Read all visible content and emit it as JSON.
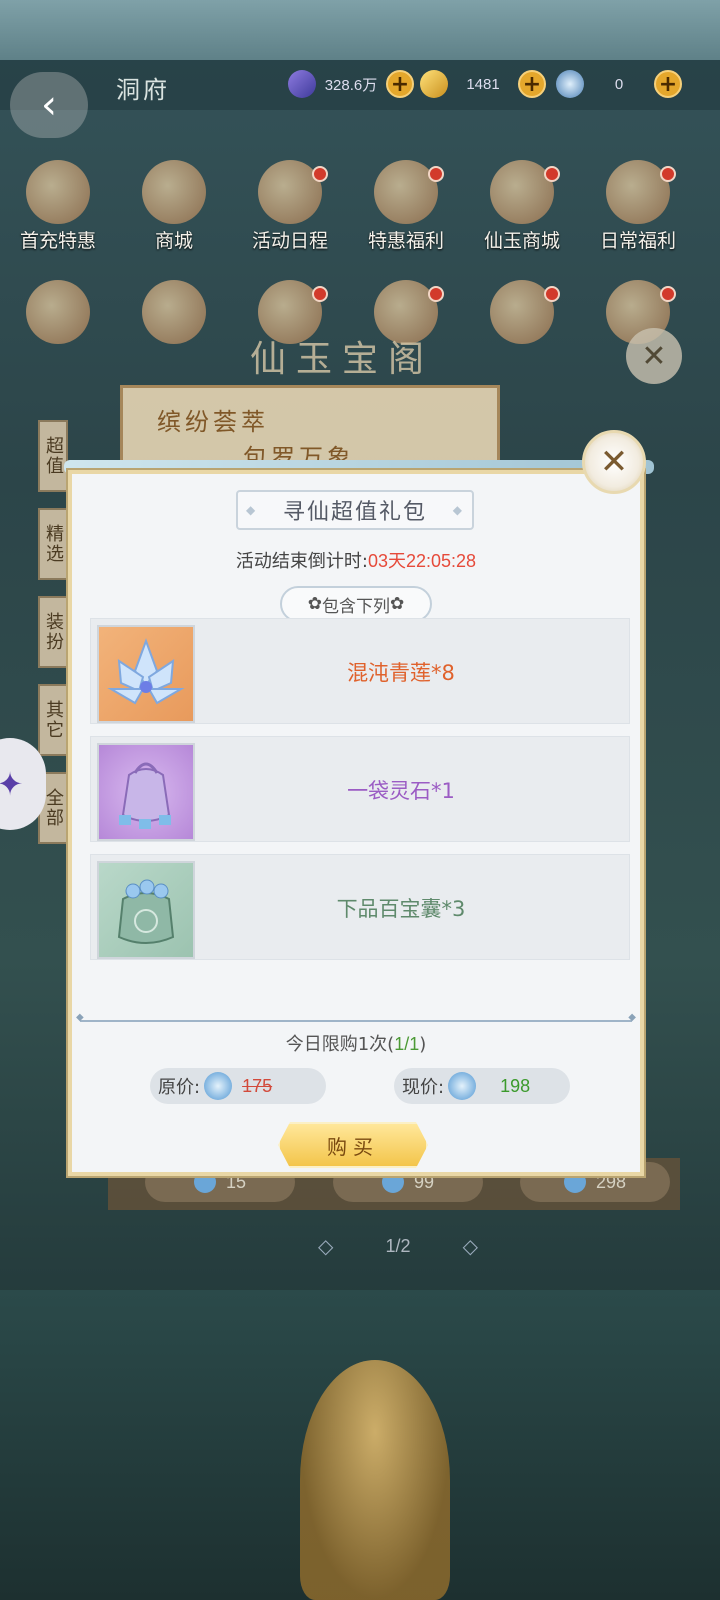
{
  "header": {
    "title": "洞府",
    "currencies": [
      {
        "icon": "spirit-crystal-icon",
        "value": "328.6万"
      },
      {
        "icon": "gold-ingot-icon",
        "value": "1481"
      },
      {
        "icon": "jade-icon",
        "value": "0"
      }
    ]
  },
  "nav_row1": [
    {
      "label": "首充特惠",
      "badge": false
    },
    {
      "label": "商城",
      "badge": false
    },
    {
      "label": "活动日程",
      "badge": true
    },
    {
      "label": "特惠福利",
      "badge": true
    },
    {
      "label": "仙玉商城",
      "badge": true
    },
    {
      "label": "日常福利",
      "badge": true
    }
  ],
  "background": {
    "shop_title": "仙玉宝阁",
    "banner_line1": "缤纷荟萃",
    "banner_line2": "包罗万象",
    "side_tabs": [
      "超值",
      "精选",
      "装扮",
      "其它",
      "全部"
    ],
    "bottom_prices": [
      "15",
      "99",
      "298"
    ],
    "page_indicator": "1/2"
  },
  "dialog": {
    "title": "寻仙超值礼包",
    "countdown_label": "活动结束倒计时:",
    "countdown_value": "03天22:05:28",
    "contains_label": "包含下列",
    "items": [
      {
        "name": "混沌青莲*8",
        "color": "#e0622c",
        "icon": "lotus-icon"
      },
      {
        "name": "一袋灵石*1",
        "color": "#9b5cc4",
        "icon": "spirit-stone-bag-icon"
      },
      {
        "name": "下品百宝囊*3",
        "color": "#5f8a6c",
        "icon": "treasure-pouch-icon"
      }
    ],
    "limit_label": "今日限购1次(",
    "limit_count": "1/1",
    "limit_close": ")",
    "original_price_label": "原价:",
    "original_price": "175",
    "current_price_label": "现价:",
    "current_price": "198",
    "buy_label": "购买"
  }
}
